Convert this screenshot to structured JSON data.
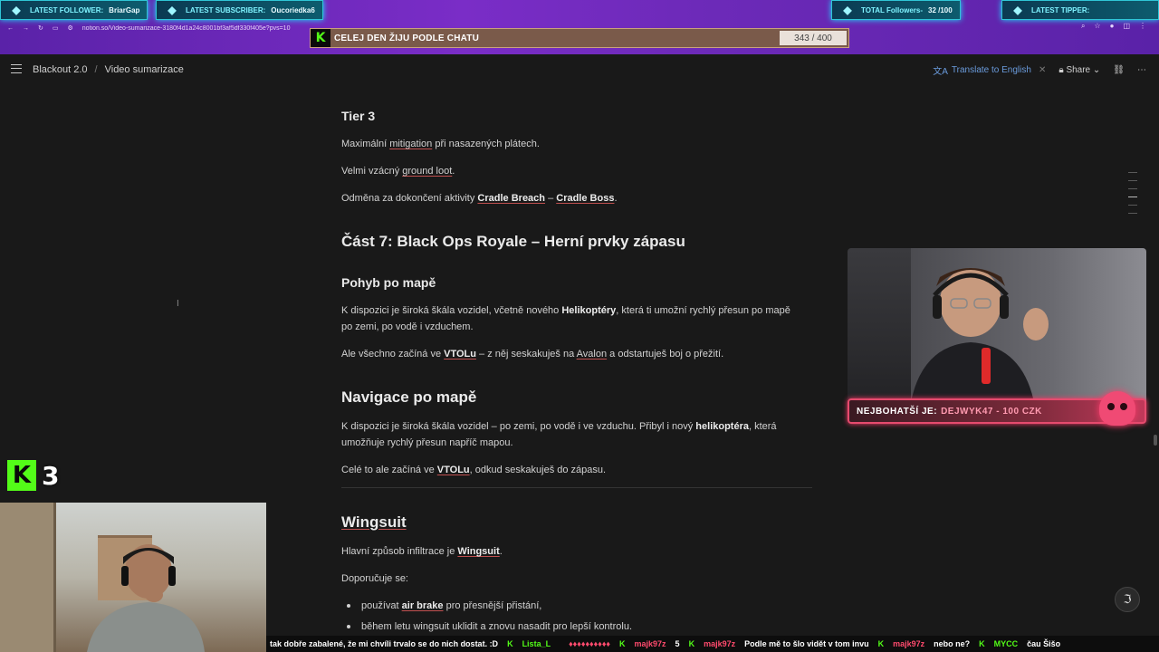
{
  "overlay": {
    "latest_follower_label": "LATEST FOLLOWER:",
    "latest_follower": "BriarGap",
    "latest_subscriber_label": "LATEST SUBSCRIBER:",
    "latest_subscriber": "Oucoriedka6",
    "total_followers_label": "TOTAL Followers-",
    "total_followers": "32 /100",
    "latest_tipper_label": "LATEST TIPPER:",
    "latest_tipper": "",
    "goal_text": "CELEJ DEN ŽIJU PODLE CHATU",
    "goal_count": "343 / 400",
    "goal_progress": 0.8575,
    "richest_label": "NEJBOHATŠÍ JE:",
    "richest_value": "DEJWYK47 - 100 CZK",
    "kick_number": "3",
    "accent": "#53fc18"
  },
  "browser": {
    "url": "notion.so/Video-sumarizace-3180f4d1a24c8001bf3af5df330f405e?pvs=10"
  },
  "notion": {
    "breadcrumbs": [
      "Blackout 2.0",
      "Video sumarizace"
    ],
    "translate": "Translate to English",
    "share": "Share"
  },
  "doc": {
    "tier3_heading": "Tier 3",
    "tier3_p1a": "Maximální ",
    "tier3_p1b": "mitigation",
    "tier3_p1c": " při nasazených plátech.",
    "tier3_p2a": "Velmi vzácný ",
    "tier3_p2b": "ground loot",
    "tier3_p2c": ".",
    "tier3_p3a": "Odměna za dokončení aktivity ",
    "tier3_p3b": "Cradle Breach",
    "tier3_p3c": " – ",
    "tier3_p3d": "Cradle Boss",
    "tier3_p3e": ".",
    "part7_heading": "Část 7: Black Ops Royale – Herní prvky zápasu",
    "move_heading": "Pohyb po mapě",
    "move_p1a": "K dispozici je široká škála vozidel, včetně nového ",
    "move_p1b": "Helikoptéry",
    "move_p1c": ", která ti umožní rychlý přesun po mapě po zemi, po vodě i vzduchem.",
    "move_p2a": "Ale všechno začíná ve ",
    "move_p2b": "VTOLu",
    "move_p2c": " – z něj seskakuješ na ",
    "move_p2d": "Avalon",
    "move_p2e": " a odstartuješ boj o přežití.",
    "nav_heading": "Navigace po mapě",
    "nav_p1a": "K dispozici je široká škála vozidel – po zemi, po vodě i ve vzduchu. Přibyl i nový ",
    "nav_p1b": "helikoptéra",
    "nav_p1c": ", která umožňuje rychlý přesun napříč mapou.",
    "nav_p2a": "Celé to ale začíná ve ",
    "nav_p2b": "VTOLu",
    "nav_p2c": ", odkud seskakuješ do zápasu.",
    "wingsuit_heading": "Wingsuit",
    "wing_p1a": "Hlavní způsob infiltrace je ",
    "wing_p1b": "Wingsuit",
    "wing_p1c": ".",
    "wing_p2": "Doporučuje se:",
    "bullet1a": "používat ",
    "bullet1b": "air brake",
    "bullet1c": " pro přesnější přistání,",
    "bullet2": "během letu wingsuit uklidit a znovu nasadit pro lepší kontrolu."
  },
  "ticker": {
    "m1": "tak dobře zabalené, že mi chvíli trvalo se do nich dostat. :D",
    "u1": "Lista_L",
    "m2": "",
    "u2": "majk97z",
    "m3": "5",
    "u3": "majk97z",
    "m4": "Podle mě to šlo vidět v tom invu",
    "u4": "majk97z",
    "m5": "nebo ne?",
    "u5": "MYCC",
    "m6": "čau Šišo"
  }
}
